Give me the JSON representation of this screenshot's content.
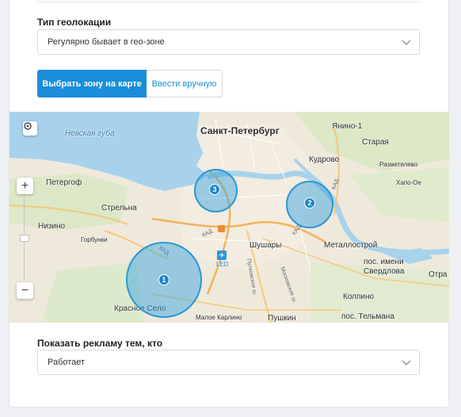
{
  "geolocation": {
    "label": "Тип геолокации",
    "selected": "Регулярно бывает в гео-зоне"
  },
  "zone_mode": {
    "primary": "Выбрать зону на карте",
    "secondary": "Ввести вручную"
  },
  "map": {
    "places": {
      "spb": "Санкт-Петербург",
      "neva_bay": "Невская губа",
      "petergof": "Петергоф",
      "strelna": "Стрельна",
      "nizino": "Низино",
      "gorbunki": "Горбунки",
      "yanino": "Янино-1",
      "staraya": "Старая",
      "kudrovo": "Кудрово",
      "razmetelevo": "Разметелево",
      "khapo_oe": "Хапо-Ое",
      "metallostroy": "Металлострой",
      "sverdlova": "пос. имени Свердлова",
      "otradnoe": "Отра",
      "shushary": "Шушары",
      "kolpino": "Колпино",
      "telmana": "пос. Тельмана",
      "krasnoe_selo": "Красное Село",
      "maloe_karlino": "Малое Карлино",
      "pushkin": "Пушкин",
      "kad": "КАД",
      "led": "LED",
      "moskovskoe": "Московское ш.",
      "pulkovskoe": "Пулковское ш."
    },
    "zones": [
      {
        "number": "1"
      },
      {
        "number": "2"
      },
      {
        "number": "3"
      }
    ],
    "controls": {
      "zoom_in": "+",
      "zoom_out": "−"
    }
  },
  "audience": {
    "label": "Показать рекламу тем, кто",
    "selected": "Работает"
  }
}
